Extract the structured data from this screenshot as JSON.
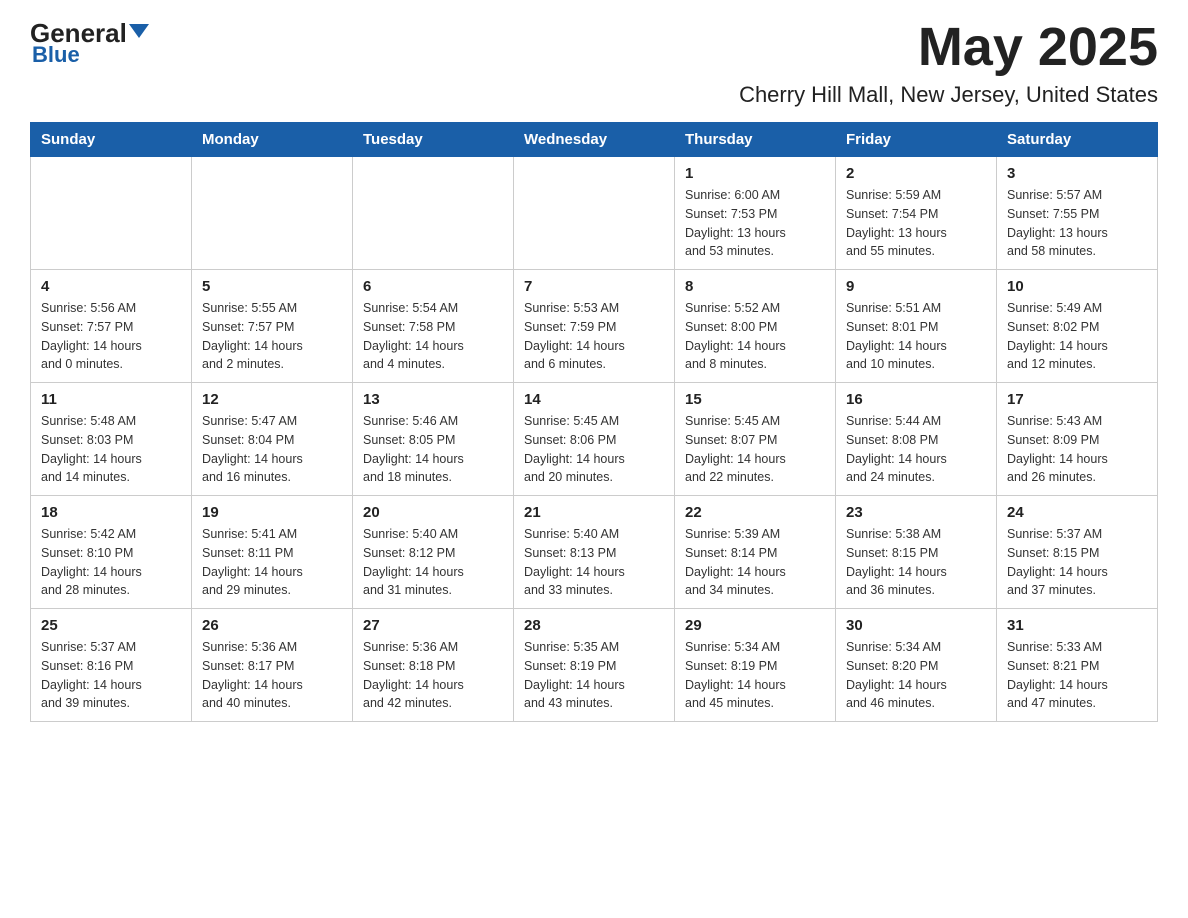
{
  "header": {
    "logo_general": "General",
    "logo_blue": "Blue",
    "month_title": "May 2025",
    "location": "Cherry Hill Mall, New Jersey, United States"
  },
  "weekdays": [
    "Sunday",
    "Monday",
    "Tuesday",
    "Wednesday",
    "Thursday",
    "Friday",
    "Saturday"
  ],
  "weeks": [
    [
      {
        "day": "",
        "info": ""
      },
      {
        "day": "",
        "info": ""
      },
      {
        "day": "",
        "info": ""
      },
      {
        "day": "",
        "info": ""
      },
      {
        "day": "1",
        "info": "Sunrise: 6:00 AM\nSunset: 7:53 PM\nDaylight: 13 hours\nand 53 minutes."
      },
      {
        "day": "2",
        "info": "Sunrise: 5:59 AM\nSunset: 7:54 PM\nDaylight: 13 hours\nand 55 minutes."
      },
      {
        "day": "3",
        "info": "Sunrise: 5:57 AM\nSunset: 7:55 PM\nDaylight: 13 hours\nand 58 minutes."
      }
    ],
    [
      {
        "day": "4",
        "info": "Sunrise: 5:56 AM\nSunset: 7:57 PM\nDaylight: 14 hours\nand 0 minutes."
      },
      {
        "day": "5",
        "info": "Sunrise: 5:55 AM\nSunset: 7:57 PM\nDaylight: 14 hours\nand 2 minutes."
      },
      {
        "day": "6",
        "info": "Sunrise: 5:54 AM\nSunset: 7:58 PM\nDaylight: 14 hours\nand 4 minutes."
      },
      {
        "day": "7",
        "info": "Sunrise: 5:53 AM\nSunset: 7:59 PM\nDaylight: 14 hours\nand 6 minutes."
      },
      {
        "day": "8",
        "info": "Sunrise: 5:52 AM\nSunset: 8:00 PM\nDaylight: 14 hours\nand 8 minutes."
      },
      {
        "day": "9",
        "info": "Sunrise: 5:51 AM\nSunset: 8:01 PM\nDaylight: 14 hours\nand 10 minutes."
      },
      {
        "day": "10",
        "info": "Sunrise: 5:49 AM\nSunset: 8:02 PM\nDaylight: 14 hours\nand 12 minutes."
      }
    ],
    [
      {
        "day": "11",
        "info": "Sunrise: 5:48 AM\nSunset: 8:03 PM\nDaylight: 14 hours\nand 14 minutes."
      },
      {
        "day": "12",
        "info": "Sunrise: 5:47 AM\nSunset: 8:04 PM\nDaylight: 14 hours\nand 16 minutes."
      },
      {
        "day": "13",
        "info": "Sunrise: 5:46 AM\nSunset: 8:05 PM\nDaylight: 14 hours\nand 18 minutes."
      },
      {
        "day": "14",
        "info": "Sunrise: 5:45 AM\nSunset: 8:06 PM\nDaylight: 14 hours\nand 20 minutes."
      },
      {
        "day": "15",
        "info": "Sunrise: 5:45 AM\nSunset: 8:07 PM\nDaylight: 14 hours\nand 22 minutes."
      },
      {
        "day": "16",
        "info": "Sunrise: 5:44 AM\nSunset: 8:08 PM\nDaylight: 14 hours\nand 24 minutes."
      },
      {
        "day": "17",
        "info": "Sunrise: 5:43 AM\nSunset: 8:09 PM\nDaylight: 14 hours\nand 26 minutes."
      }
    ],
    [
      {
        "day": "18",
        "info": "Sunrise: 5:42 AM\nSunset: 8:10 PM\nDaylight: 14 hours\nand 28 minutes."
      },
      {
        "day": "19",
        "info": "Sunrise: 5:41 AM\nSunset: 8:11 PM\nDaylight: 14 hours\nand 29 minutes."
      },
      {
        "day": "20",
        "info": "Sunrise: 5:40 AM\nSunset: 8:12 PM\nDaylight: 14 hours\nand 31 minutes."
      },
      {
        "day": "21",
        "info": "Sunrise: 5:40 AM\nSunset: 8:13 PM\nDaylight: 14 hours\nand 33 minutes."
      },
      {
        "day": "22",
        "info": "Sunrise: 5:39 AM\nSunset: 8:14 PM\nDaylight: 14 hours\nand 34 minutes."
      },
      {
        "day": "23",
        "info": "Sunrise: 5:38 AM\nSunset: 8:15 PM\nDaylight: 14 hours\nand 36 minutes."
      },
      {
        "day": "24",
        "info": "Sunrise: 5:37 AM\nSunset: 8:15 PM\nDaylight: 14 hours\nand 37 minutes."
      }
    ],
    [
      {
        "day": "25",
        "info": "Sunrise: 5:37 AM\nSunset: 8:16 PM\nDaylight: 14 hours\nand 39 minutes."
      },
      {
        "day": "26",
        "info": "Sunrise: 5:36 AM\nSunset: 8:17 PM\nDaylight: 14 hours\nand 40 minutes."
      },
      {
        "day": "27",
        "info": "Sunrise: 5:36 AM\nSunset: 8:18 PM\nDaylight: 14 hours\nand 42 minutes."
      },
      {
        "day": "28",
        "info": "Sunrise: 5:35 AM\nSunset: 8:19 PM\nDaylight: 14 hours\nand 43 minutes."
      },
      {
        "day": "29",
        "info": "Sunrise: 5:34 AM\nSunset: 8:19 PM\nDaylight: 14 hours\nand 45 minutes."
      },
      {
        "day": "30",
        "info": "Sunrise: 5:34 AM\nSunset: 8:20 PM\nDaylight: 14 hours\nand 46 minutes."
      },
      {
        "day": "31",
        "info": "Sunrise: 5:33 AM\nSunset: 8:21 PM\nDaylight: 14 hours\nand 47 minutes."
      }
    ]
  ]
}
